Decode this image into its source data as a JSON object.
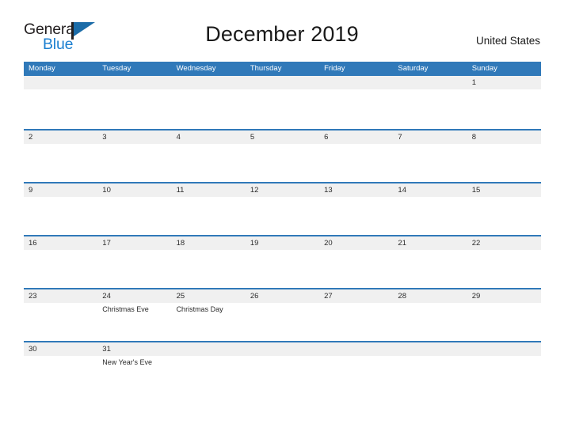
{
  "brand": {
    "name_dark": "General",
    "name_light": "Blue",
    "flag_icon": "pennant-flag-icon",
    "accent_color": "#1b7fd0"
  },
  "header": {
    "title": "December 2019",
    "country": "United States"
  },
  "theme": {
    "header_blue": "#3079b9",
    "band_gray": "#f0f0f0",
    "text": "#2b2b2b"
  },
  "calendar": {
    "month": "December",
    "year": "2019",
    "weekday_headers": [
      "Monday",
      "Tuesday",
      "Wednesday",
      "Thursday",
      "Friday",
      "Saturday",
      "Sunday"
    ],
    "weeks": [
      {
        "days": [
          {
            "num": "",
            "events": []
          },
          {
            "num": "",
            "events": []
          },
          {
            "num": "",
            "events": []
          },
          {
            "num": "",
            "events": []
          },
          {
            "num": "",
            "events": []
          },
          {
            "num": "",
            "events": []
          },
          {
            "num": "1",
            "events": []
          }
        ]
      },
      {
        "days": [
          {
            "num": "2",
            "events": []
          },
          {
            "num": "3",
            "events": []
          },
          {
            "num": "4",
            "events": []
          },
          {
            "num": "5",
            "events": []
          },
          {
            "num": "6",
            "events": []
          },
          {
            "num": "7",
            "events": []
          },
          {
            "num": "8",
            "events": []
          }
        ]
      },
      {
        "days": [
          {
            "num": "9",
            "events": []
          },
          {
            "num": "10",
            "events": []
          },
          {
            "num": "11",
            "events": []
          },
          {
            "num": "12",
            "events": []
          },
          {
            "num": "13",
            "events": []
          },
          {
            "num": "14",
            "events": []
          },
          {
            "num": "15",
            "events": []
          }
        ]
      },
      {
        "days": [
          {
            "num": "16",
            "events": []
          },
          {
            "num": "17",
            "events": []
          },
          {
            "num": "18",
            "events": []
          },
          {
            "num": "19",
            "events": []
          },
          {
            "num": "20",
            "events": []
          },
          {
            "num": "21",
            "events": []
          },
          {
            "num": "22",
            "events": []
          }
        ]
      },
      {
        "days": [
          {
            "num": "23",
            "events": []
          },
          {
            "num": "24",
            "events": [
              "Christmas Eve"
            ]
          },
          {
            "num": "25",
            "events": [
              "Christmas Day"
            ]
          },
          {
            "num": "26",
            "events": []
          },
          {
            "num": "27",
            "events": []
          },
          {
            "num": "28",
            "events": []
          },
          {
            "num": "29",
            "events": []
          }
        ]
      },
      {
        "days": [
          {
            "num": "30",
            "events": []
          },
          {
            "num": "31",
            "events": [
              "New Year's Eve"
            ]
          },
          {
            "num": "",
            "events": []
          },
          {
            "num": "",
            "events": []
          },
          {
            "num": "",
            "events": []
          },
          {
            "num": "",
            "events": []
          },
          {
            "num": "",
            "events": []
          }
        ]
      }
    ]
  }
}
